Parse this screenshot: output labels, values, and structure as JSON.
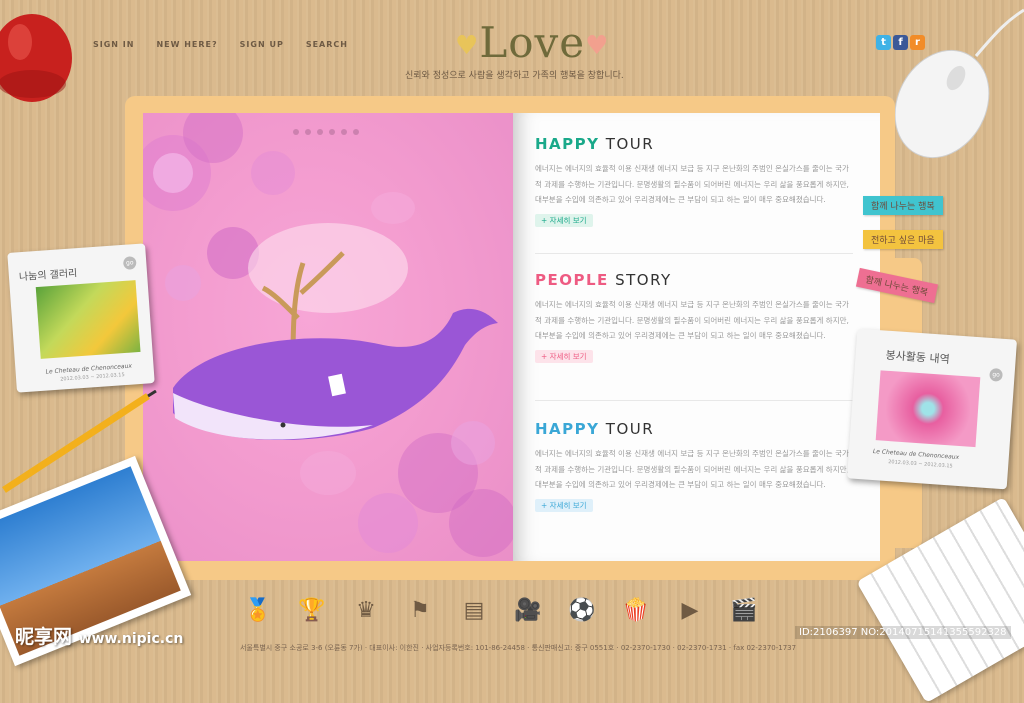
{
  "nav": {
    "items": [
      "SIGN IN",
      "NEW HERE?",
      "SIGN UP",
      "SEARCH"
    ]
  },
  "logo": {
    "text": "Love"
  },
  "tagline": "신뢰와 정성으로 사람을 생각하고 가족의 행복을 창합니다.",
  "social": {
    "twitter": "t",
    "facebook": "f",
    "rss": "r"
  },
  "sections": [
    {
      "title_a": "HAPPY",
      "title_b": "TOUR",
      "accent": "#1aa98a",
      "body": "에너지는 에너지의 효율적 이용 신재생 에너지 보급 등 지구 온난화의 주범인 온실가스를 줄이는 국가적 과제를 수행하는 기관입니다. 문명생활의 필수품이 되어버린 에너지는 우리 삶을 풍요롭게 하지만, 대부분을 수입에 의존하고 있어 우리경제에는 큰 부담이 되고 하는 일이 매우 중요해졌습니다.",
      "more": "+ 자세히 보기",
      "more_bg": "#dff4ec",
      "more_color": "#1aa98a"
    },
    {
      "title_a": "PEOPLE",
      "title_b": "STORY",
      "accent": "#ee5b82",
      "body": "에너지는 에너지의 효율적 이용 신재생 에너지 보급 등 지구 온난화의 주범인 온실가스를 줄이는 국가적 과제를 수행하는 기관입니다. 문명생활의 필수품이 되어버린 에너지는 우리 삶을 풍요롭게 하지만, 대부분을 수입에 의존하고 있어 우리경제에는 큰 부담이 되고 하는 일이 매우 중요해졌습니다.",
      "more": "+ 자세히 보기",
      "more_bg": "#fde3ea",
      "more_color": "#ee5b82"
    },
    {
      "title_a": "HAPPY",
      "title_b": "TOUR",
      "accent": "#3aa7d6",
      "body": "에너지는 에너지의 효율적 이용 신재생 에너지 보급 등 지구 온난화의 주범인 온실가스를 줄이는 국가적 과제를 수행하는 기관입니다. 문명생활의 필수품이 되어버린 에너지는 우리 삶을 풍요롭게 하지만, 대부분을 수입에 의존하고 있어 우리경제에는 큰 부담이 되고 하는 일이 매우 중요해졌습니다.",
      "more": "+ 자세히 보기",
      "more_bg": "#dff0fa",
      "more_color": "#3aa7d6"
    }
  ],
  "notes": [
    "함께 나누는 행복",
    "전하고 싶은 마음",
    "함께 나누는 행복"
  ],
  "gallery_left": {
    "title": "나눔의 갤러리",
    "badge": "go",
    "caption": "Le Cheteau de Chenonceaux",
    "date": "2012.03.03 ~ 2012.03.15"
  },
  "gallery_right": {
    "title": "봉사활동 내역",
    "badge": "go",
    "caption": "Le Cheteau de Chenonceaux",
    "date": "2012.03.03 ~ 2012.03.15"
  },
  "footer": "서울특별시 중구 소공로 3-6 (오륜동 7가) · 대표이사: 이한진 · 사업자등록번호: 101-86-24458 · 통신판매신고: 중구 0551호 · 02-2370-1730 · 02-2370-1731 · fax 02-2370-1737",
  "watermark": {
    "brand": "昵享网",
    "url": "www.nipic.cn"
  },
  "idline": "ID:2106397 NO:20140715141355592328"
}
